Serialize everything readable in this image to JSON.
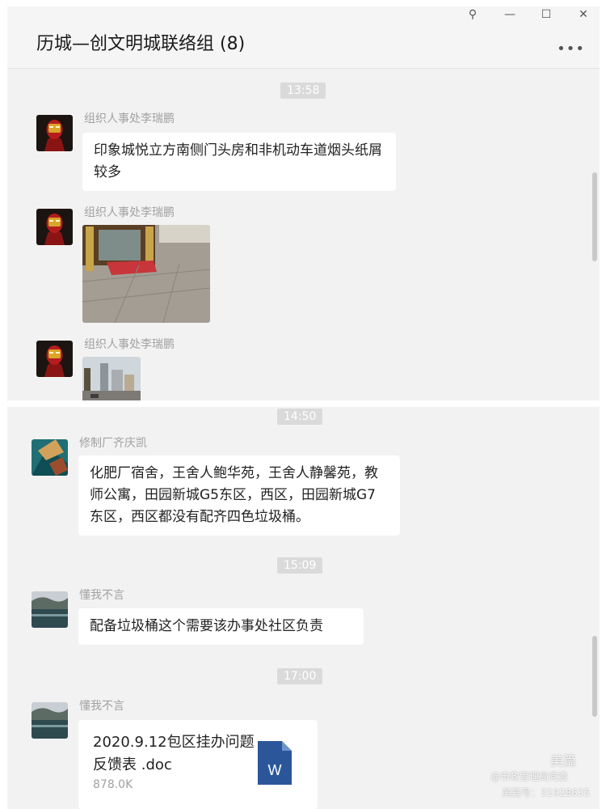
{
  "header": {
    "title": "历城—创文明城联络组 (8)",
    "more_label": "•••"
  },
  "window_controls": [
    {
      "name": "pin-icon",
      "glyph": "⚲"
    },
    {
      "name": "minimize-icon",
      "glyph": "—"
    },
    {
      "name": "maximize-icon",
      "glyph": "☐"
    },
    {
      "name": "close-icon",
      "glyph": "✕"
    }
  ],
  "messages_top": [
    {
      "type": "time",
      "text": "13:58"
    },
    {
      "type": "text",
      "sender": "组织人事处李瑞鹏",
      "avatar_icon": "iron-man-avatar-icon",
      "text": "印象城悦立方南侧门头房和非机动车道烟头纸屑较多"
    },
    {
      "type": "image",
      "sender": "组织人事处李瑞鹏",
      "avatar_icon": "iron-man-avatar-icon",
      "image_icon": "street-entrance-photo-icon"
    },
    {
      "type": "image",
      "sender": "组织人事处李瑞鹏",
      "avatar_icon": "iron-man-avatar-icon",
      "image_icon": "street-buildings-photo-icon"
    }
  ],
  "messages_bottom": [
    {
      "type": "time",
      "text": "14:50"
    },
    {
      "type": "text",
      "sender": "修制厂齐庆凯",
      "avatar_icon": "teal-abstract-avatar-icon",
      "text": "化肥厂宿舍，王舍人鲍华苑，王舍人静馨苑，教师公寓，田园新城G5东区，西区，田园新城G7东区，西区都没有配齐四色垃圾桶。"
    },
    {
      "type": "time",
      "text": "15:09"
    },
    {
      "type": "text",
      "sender": "懂我不言",
      "avatar_icon": "lake-landscape-avatar-icon",
      "text": "配备垃圾桶这个需要该办事处社区负责"
    },
    {
      "type": "time",
      "text": "17:00"
    },
    {
      "type": "file",
      "sender": "懂我不言",
      "avatar_icon": "lake-landscape-avatar-icon",
      "file_name": "2020.9.12包区挂办问题反馈表 .doc",
      "file_size": "878.0K",
      "file_icon": "word-doc-icon",
      "file_icon_letter": "W"
    }
  ],
  "watermark": {
    "brand": "美篇",
    "line1": "@市政管理局党委",
    "line2": "美篇号：31928635"
  },
  "colors": {
    "panel_bg": "#f2f2f2",
    "bubble_bg": "#ffffff",
    "time_badge": "#dadada",
    "name_text": "#a2a2a2",
    "word_blue": "#2b579a"
  }
}
